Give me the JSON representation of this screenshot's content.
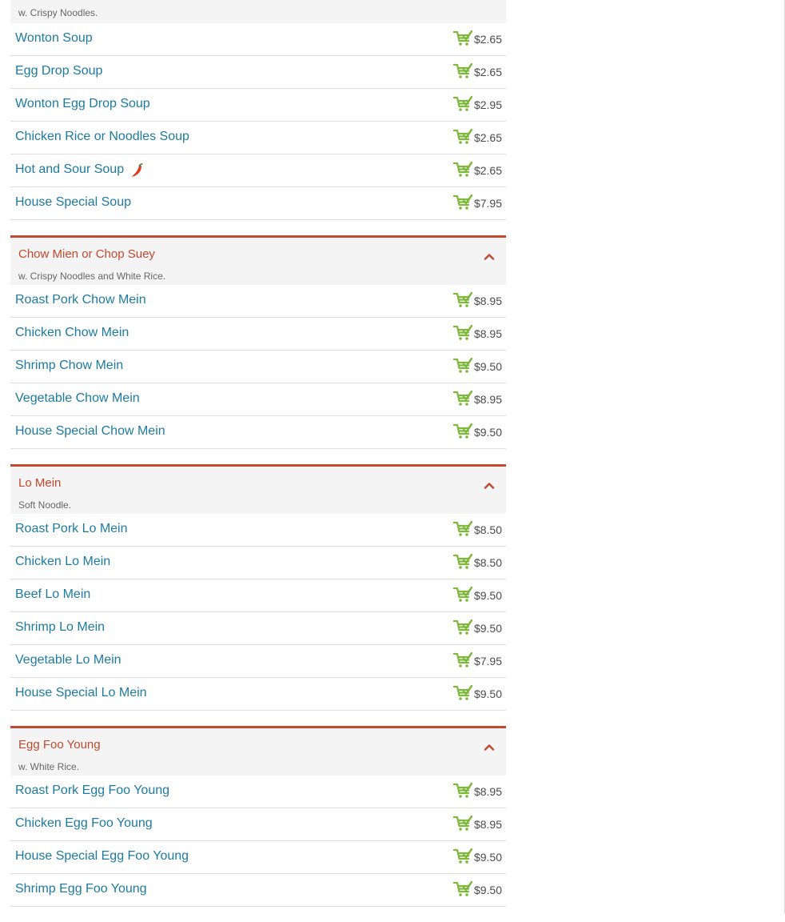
{
  "colors": {
    "accent": "#c2492d",
    "link": "#1c7aa0",
    "cart": "#7db83a"
  },
  "icons": {
    "cart": "shopping-cart-icon",
    "spicy": "chili-pepper-icon",
    "collapse": "chevron-up-icon"
  },
  "categories": [
    {
      "title": "",
      "description": "w. Crispy Noodles.",
      "items": [
        {
          "name": "Wonton Soup",
          "price": "$2.65"
        },
        {
          "name": "Egg Drop Soup",
          "price": "$2.65"
        },
        {
          "name": "Wonton Egg Drop Soup",
          "price": "$2.95"
        },
        {
          "name": "Chicken Rice or Noodles Soup",
          "price": "$2.65"
        },
        {
          "name": "Hot and Sour Soup",
          "price": "$2.65",
          "spicy": true
        },
        {
          "name": "House Special Soup",
          "price": "$7.95"
        }
      ]
    },
    {
      "title": "Chow Mien or Chop Suey",
      "description": "w. Crispy Noodles and White Rice.",
      "items": [
        {
          "name": "Roast Pork Chow Mein",
          "price": "$8.95"
        },
        {
          "name": "Chicken Chow Mein",
          "price": "$8.95"
        },
        {
          "name": "Shrimp Chow Mein",
          "price": "$9.50"
        },
        {
          "name": "Vegetable Chow Mein",
          "price": "$8.95"
        },
        {
          "name": "House Special Chow Mein",
          "price": "$9.50"
        }
      ]
    },
    {
      "title": "Lo Mein",
      "description": "Soft Noodle.",
      "items": [
        {
          "name": "Roast Pork Lo Mein",
          "price": "$8.50"
        },
        {
          "name": "Chicken Lo Mein",
          "price": "$8.50"
        },
        {
          "name": "Beef Lo Mein",
          "price": "$9.50"
        },
        {
          "name": "Shrimp Lo Mein",
          "price": "$9.50"
        },
        {
          "name": "Vegetable Lo Mein",
          "price": "$7.95"
        },
        {
          "name": "House Special Lo Mein",
          "price": "$9.50"
        }
      ]
    },
    {
      "title": "Egg Foo Young",
      "description": "w. White Rice.",
      "items": [
        {
          "name": "Roast Pork Egg Foo Young",
          "price": "$8.95"
        },
        {
          "name": "Chicken Egg Foo Young",
          "price": "$8.95"
        },
        {
          "name": "House Special Egg Foo Young",
          "price": "$9.50"
        },
        {
          "name": "Shrimp Egg Foo Young",
          "price": "$9.50"
        }
      ]
    }
  ]
}
